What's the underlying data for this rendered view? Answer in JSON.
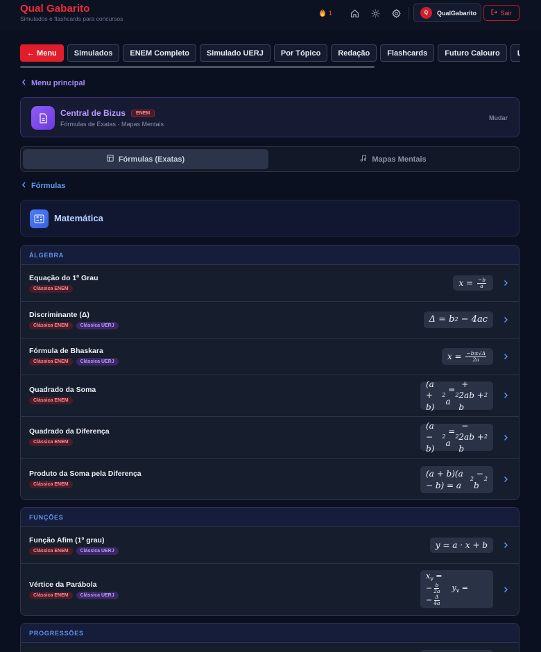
{
  "header": {
    "brand_title": "Qual Gabarito",
    "brand_subtitle": "Simulados e flashcards para concursos",
    "streak_count": "1",
    "user_initial": "Q",
    "user_name": "QualGabarito",
    "logout_label": "Sair"
  },
  "tabs": [
    {
      "label": "← Menu",
      "active": true
    },
    {
      "label": "Simulados"
    },
    {
      "label": "ENEM Completo"
    },
    {
      "label": "Simulado UERJ"
    },
    {
      "label": "Por Tópico"
    },
    {
      "label": "Redação"
    },
    {
      "label": "Flashcards"
    },
    {
      "label": "Futuro Calouro"
    },
    {
      "label": "Líderes"
    }
  ],
  "nav": {
    "menu_principal": "Menu principal",
    "formulas_back": "Fórmulas"
  },
  "bizus": {
    "title": "Central de Bizus",
    "badge": "ENEM",
    "subtitle": "Fórmulas de Exatas · Mapas Mentais",
    "change_label": "Mudar"
  },
  "segment": {
    "formulas": "Fórmulas (Exatas)",
    "mapas": "Mapas Mentais",
    "active": "formulas"
  },
  "subject": {
    "title": "Matemática"
  },
  "sections": [
    {
      "title": "ÁLGEBRA",
      "rows": [
        {
          "name": "Equação do 1º Grau",
          "badges": [
            "Clássica ENEM"
          ],
          "formula_text": "x = −b/a"
        },
        {
          "name": "Discriminante (Δ)",
          "badges": [
            "Clássica ENEM",
            "Clássica UERJ"
          ],
          "formula_text": "Δ = b² − 4ac"
        },
        {
          "name": "Fórmula de Bhaskara",
          "badges": [
            "Clássica ENEM",
            "Clássica UERJ"
          ],
          "formula_text": "x = (−b ± √Δ)/2a"
        },
        {
          "name": "Quadrado da Soma",
          "badges": [
            "Clássica ENEM"
          ],
          "formula_text": "(a + b)² = a² + 2ab + b²"
        },
        {
          "name": "Quadrado da Diferença",
          "badges": [
            "Clássica ENEM"
          ],
          "formula_text": "(a − b)² = a² − 2ab + b²"
        },
        {
          "name": "Produto da Soma pela Diferença",
          "badges": [
            "Clássica ENEM"
          ],
          "formula_text": "(a + b)(a − b) = a² − b²"
        }
      ]
    },
    {
      "title": "FUNÇÕES",
      "rows": [
        {
          "name": "Função Afim (1º grau)",
          "badges": [
            "Clássica ENEM",
            "Clássica UERJ"
          ],
          "formula_text": "y = a · x + b"
        },
        {
          "name": "Vértice da Parábola",
          "badges": [
            "Clássica ENEM",
            "Clássica UERJ"
          ],
          "formula_text": "xᵥ = −b/2a  yᵥ = −Δ/4a"
        }
      ]
    },
    {
      "title": "PROGRESSÕES",
      "rows": []
    }
  ],
  "colors": {
    "accent_red": "#e11d2b",
    "accent_purple": "#a38bf7",
    "accent_blue": "#5d9cf5",
    "background": "#0b1020"
  }
}
